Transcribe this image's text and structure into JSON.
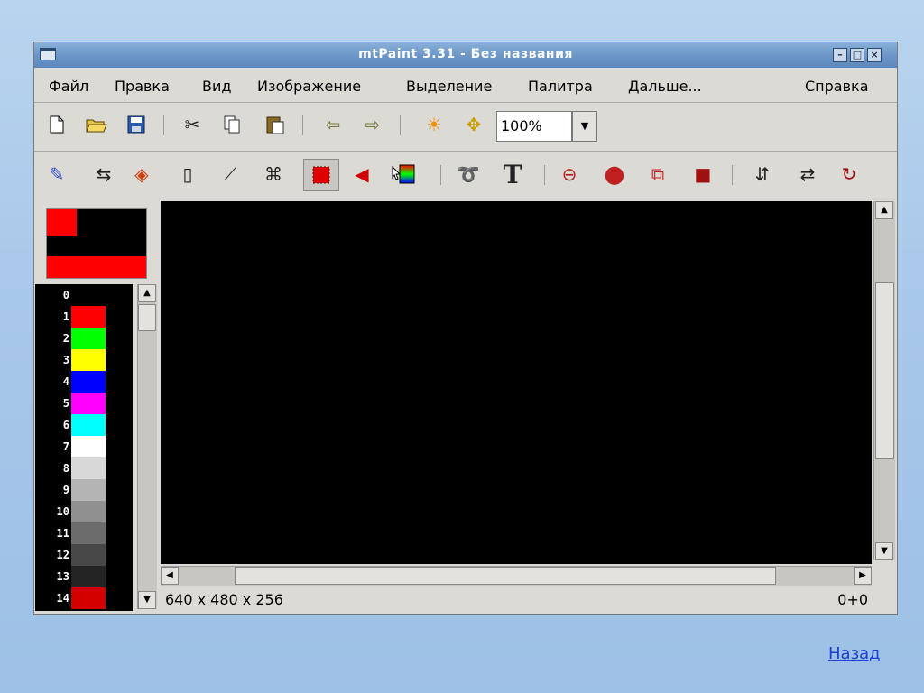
{
  "window": {
    "title": "mtPaint 3.31 - Без названия"
  },
  "menu": [
    "Файл",
    "Правка",
    "Вид",
    "Изображение",
    "Выделение",
    "Палитра",
    "Дальше...",
    "Справка"
  ],
  "toolbar_main": {
    "icons": [
      "new-file-icon",
      "open-folder-icon",
      "save-icon",
      "cut-icon",
      "copy-icon",
      "paste-icon",
      "undo-icon",
      "redo-icon",
      "brightness-icon",
      "pan-icon"
    ],
    "zoom": "100%"
  },
  "toolbar_tools": {
    "icons": [
      "pencil-icon",
      "shuffle-icon",
      "fill-icon",
      "line-icon",
      "brush-icon",
      "clone-icon",
      "rect-select-icon",
      "polygon-select-icon",
      "gradient-icon",
      "lasso-icon",
      "text-icon",
      "ellipse-outline-icon",
      "ellipse-fill-icon",
      "rect-outline-icon",
      "rect-fill-icon",
      "flip-vertical-icon",
      "flip-horizontal-icon",
      "rotate-icon"
    ]
  },
  "palette": [
    {
      "index": "0",
      "color": "#000000"
    },
    {
      "index": "1",
      "color": "#ff0000"
    },
    {
      "index": "2",
      "color": "#00ff00"
    },
    {
      "index": "3",
      "color": "#ffff00"
    },
    {
      "index": "4",
      "color": "#0000ff"
    },
    {
      "index": "5",
      "color": "#ff00ff"
    },
    {
      "index": "6",
      "color": "#00ffff"
    },
    {
      "index": "7",
      "color": "#ffffff"
    },
    {
      "index": "8",
      "color": "#d8d8d8"
    },
    {
      "index": "9",
      "color": "#b4b4b4"
    },
    {
      "index": "10",
      "color": "#909090"
    },
    {
      "index": "11",
      "color": "#6c6c6c"
    },
    {
      "index": "12",
      "color": "#484848"
    },
    {
      "index": "13",
      "color": "#242424"
    },
    {
      "index": "14",
      "color": "#d40000"
    }
  ],
  "status": {
    "size": "640 x 480 x 256",
    "coords": "0+0"
  },
  "nav": {
    "back": "Назад"
  }
}
